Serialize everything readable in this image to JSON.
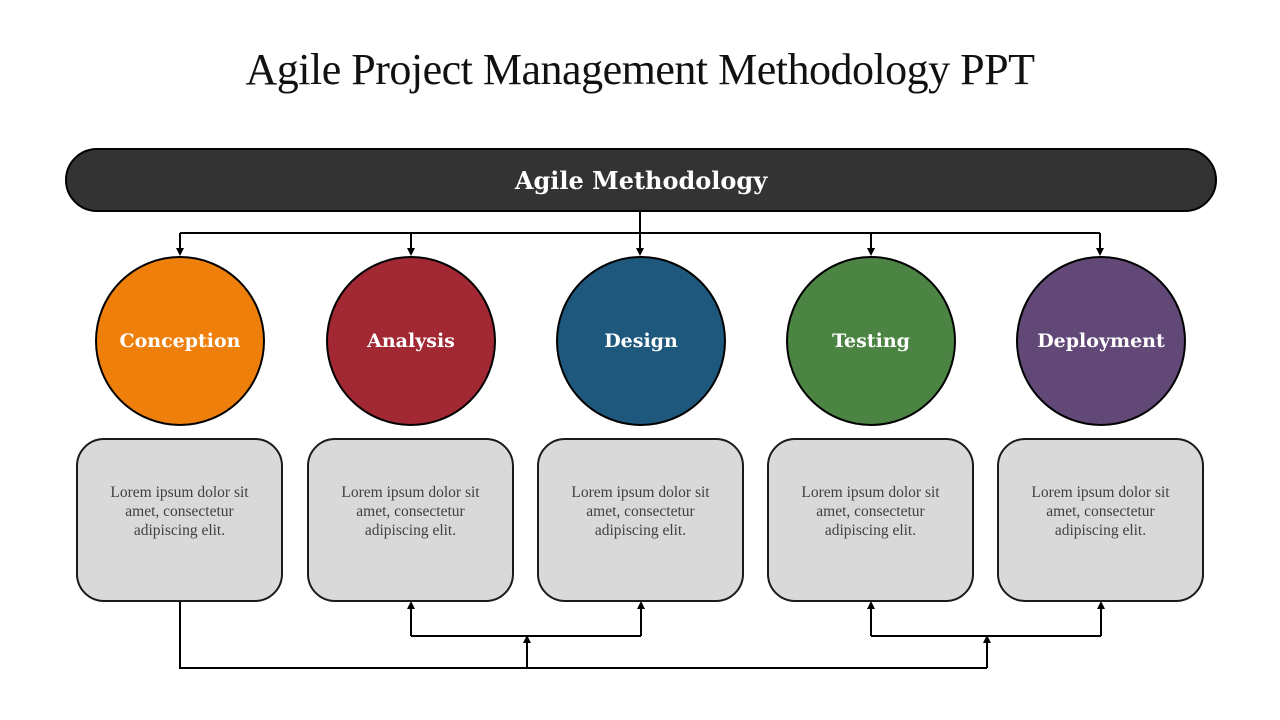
{
  "title": "Agile Project Management Methodology PPT",
  "header_bar": {
    "label": "Agile Methodology",
    "color": "#333333"
  },
  "phases": [
    {
      "label": "Conception",
      "color": "#ef7f0b",
      "description": "Lorem ipsum dolor sit amet, consectetur adipiscing elit."
    },
    {
      "label": "Analysis",
      "color": "#a22834",
      "description": "Lorem ipsum dolor sit amet, consectetur adipiscing elit."
    },
    {
      "label": "Design",
      "color": "#1e587c",
      "description": "Lorem ipsum dolor sit amet, consectetur adipiscing elit."
    },
    {
      "label": "Testing",
      "color": "#4c8443",
      "description": "Lorem ipsum dolor sit amet, consectetur adipiscing elit."
    },
    {
      "label": "Deployment",
      "color": "#614877",
      "description": "Lorem ipsum dolor sit amet, consectetur adipiscing elit."
    }
  ],
  "card_fill": "#d9d9d9"
}
